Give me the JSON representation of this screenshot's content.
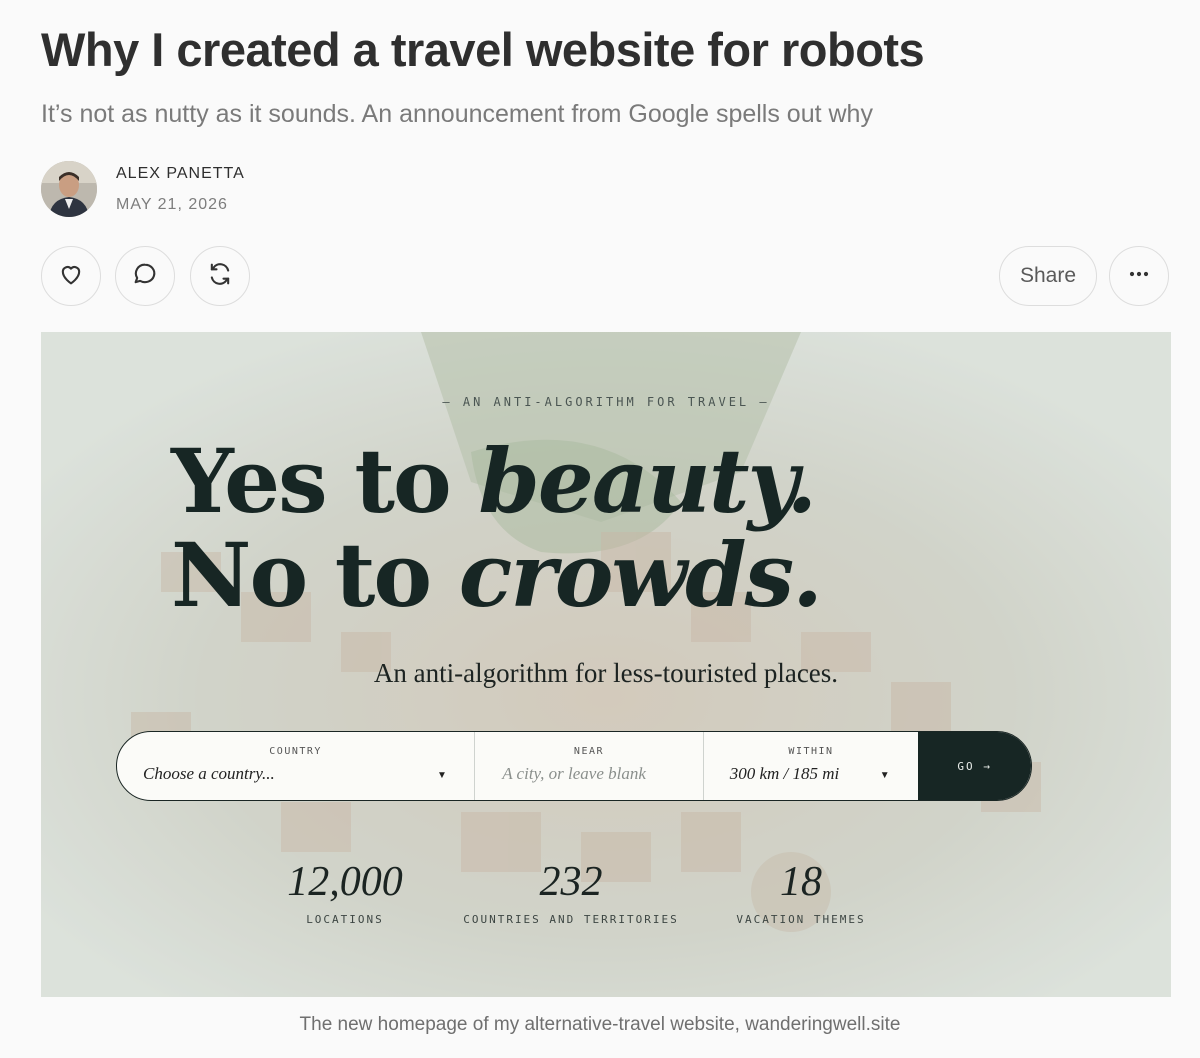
{
  "article": {
    "title": "Why I created a travel website for robots",
    "subtitle": "It’s not as nutty as it sounds. An announcement from Google spells out why",
    "author": "ALEX PANETTA",
    "date": "MAY 21, 2026"
  },
  "actions": {
    "like_icon": "heart-icon",
    "comment_icon": "comment-icon",
    "restack_icon": "restack-icon",
    "share_label": "Share",
    "more_icon": "more-icon"
  },
  "hero": {
    "tagline": "— AN ANTI-ALGORITHM FOR TRAVEL —",
    "headline_line1_plain": "Yes to ",
    "headline_line1_italic": "beauty.",
    "headline_line2_plain": "No to ",
    "headline_line2_italic": "crowds.",
    "lead": "An anti-algorithm for less-touristed places.",
    "search": {
      "country_label": "COUNTRY",
      "country_value": "Choose a country...",
      "near_label": "NEAR",
      "near_placeholder": "A city, or leave blank",
      "within_label": "WITHIN",
      "within_value": "300 km / 185 mi",
      "go_label": "GO →"
    },
    "stats": [
      {
        "value": "12,000",
        "label": "LOCATIONS"
      },
      {
        "value": "232",
        "label": "COUNTRIES AND TERRITORIES"
      },
      {
        "value": "18",
        "label": "VACATION THEMES"
      }
    ]
  },
  "caption": "The new homepage of my alternative-travel website, wanderingwell.site",
  "colors": {
    "hero_dark": "#172624",
    "page_bg": "#fafafa"
  }
}
